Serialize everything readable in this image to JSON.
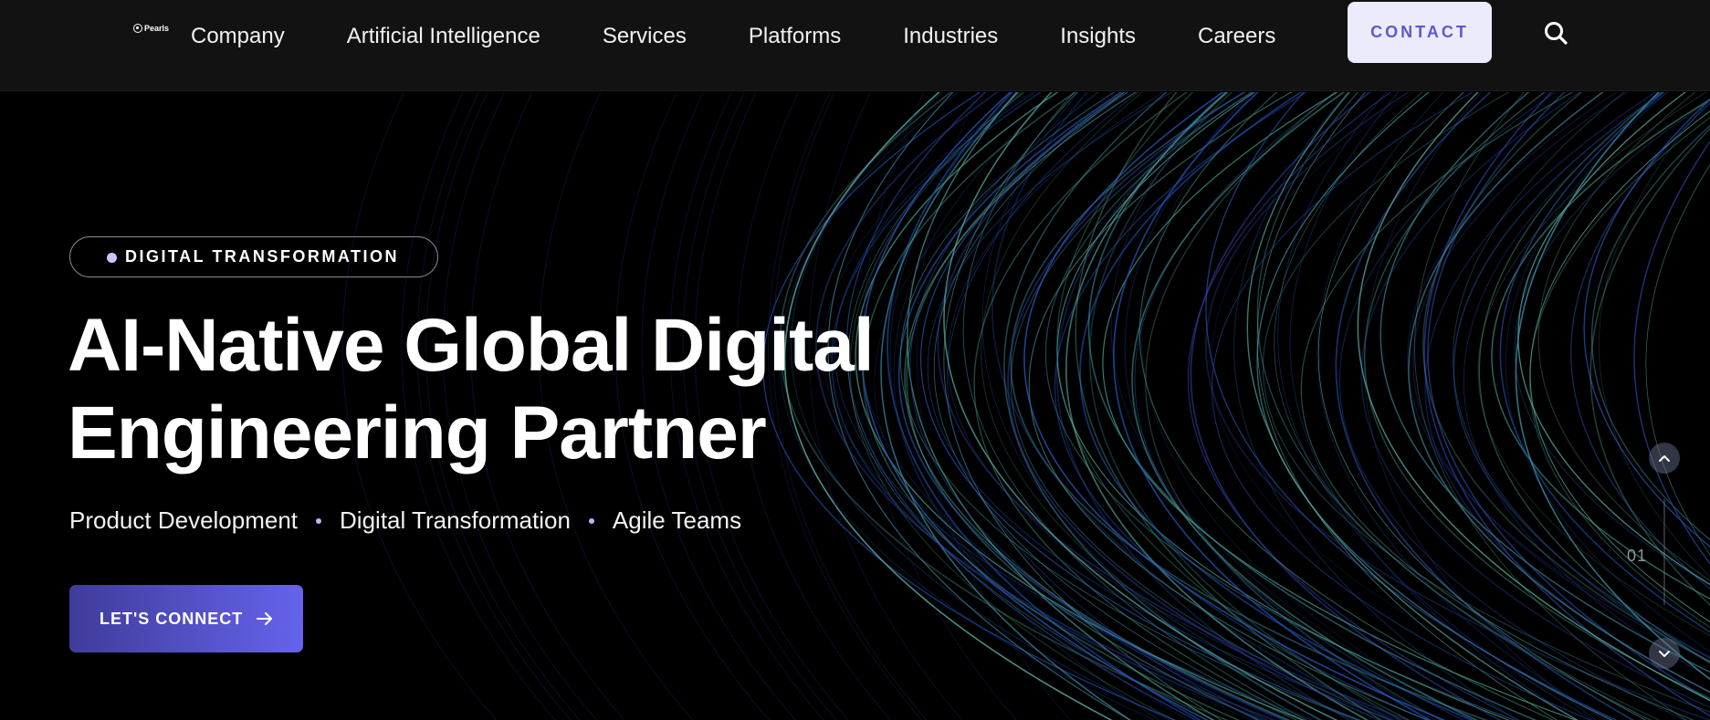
{
  "header": {
    "logo_text": "Pearls",
    "nav": [
      "Company",
      "Artificial Intelligence",
      "Services",
      "Platforms",
      "Industries",
      "Insights",
      "Careers"
    ],
    "contact_label": "CONTACT",
    "search_icon": "search-icon"
  },
  "hero": {
    "tag": "DIGITAL TRANSFORMATION",
    "headline_line1": "AI-Native Global Digital",
    "headline_line2": "Engineering Partner",
    "sub_items": [
      "Product Development",
      "Digital Transformation",
      "Agile Teams"
    ],
    "cta_label": "LET'S CONNECT",
    "slide_number": "01"
  },
  "colors": {
    "accent": "#6663ec",
    "accent_dark": "#3f3c99",
    "contact_bg": "#ecebfb",
    "contact_text": "#5d5acb",
    "header_bg": "#121212"
  }
}
